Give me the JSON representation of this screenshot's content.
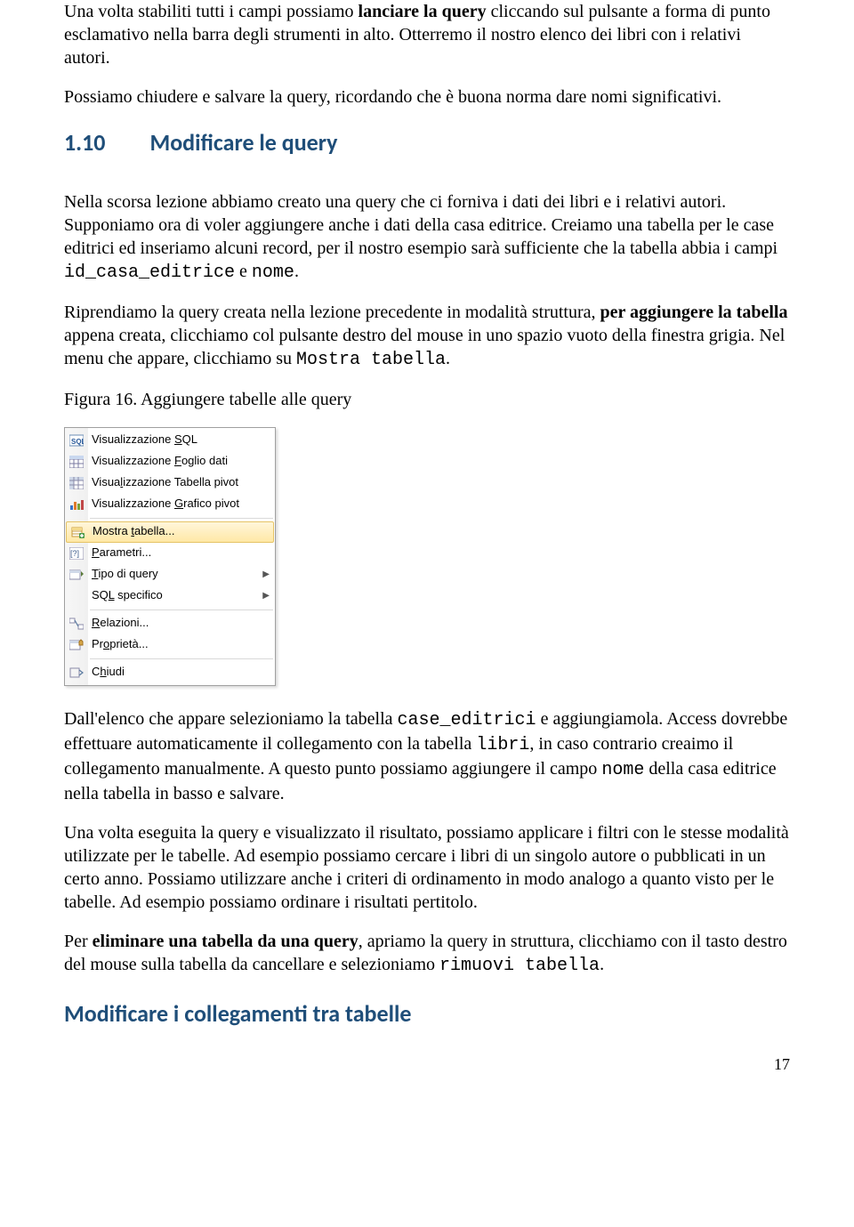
{
  "para1": "Una volta stabiliti tutti i campi possiamo lanciare la query cliccando sul pulsante a forma di punto esclamativo nella barra degli strumenti in alto. Otterremo il nostro elenco dei libri con i relativi autori.",
  "para2": "Possiamo chiudere e salvare la query, ricordando che è buona norma dare nomi significativi.",
  "heading": {
    "num": "1.10",
    "title": "Modificare le query"
  },
  "para3_a": "Nella scorsa lezione abbiamo creato una query che ci forniva i dati dei libri e i relativi autori. Supponiamo ora di voler aggiungere anche i dati della casa editrice. Creiamo una tabella per le case editrici ed inseriamo alcuni record, per il nostro esempio sarà sufficiente che la tabella abbia i campi ",
  "para3_code": "id_casa_editrice",
  "para3_b": " e ",
  "para3_code2": "nome",
  "para3_c": ".",
  "para4_a": "Riprendiamo la query creata nella lezione precedente in modalità struttura, ",
  "para4_bold": "per aggiungere la tabella",
  "para4_b": " appena creata, clicchiamo col pulsante destro del mouse in uno spazio vuoto della finestra grigia. Nel menu che appare, clicchiamo su ",
  "para4_code": "Mostra tabella",
  "para4_c": ".",
  "figure_caption": "Figura 16. Aggiungere tabelle alle query",
  "menu": {
    "items": [
      {
        "pre": "Visualizzazione ",
        "u": "S",
        "post": "QL",
        "icon": "sql",
        "arrow": false
      },
      {
        "pre": "Visualizzazione ",
        "u": "F",
        "post": "oglio dati",
        "icon": "grid",
        "arrow": false
      },
      {
        "pre": "Visua",
        "u": "l",
        "post": "izzazione Tabella pivot",
        "icon": "pivot-table",
        "arrow": false
      },
      {
        "pre": "Visualizzazione ",
        "u": "G",
        "post": "rafico pivot",
        "icon": "chart",
        "arrow": false
      },
      {
        "pre": "Mostra ",
        "u": "t",
        "post": "abella...",
        "icon": "add-table",
        "arrow": false,
        "highlight": true
      },
      {
        "pre": "",
        "u": "P",
        "post": "arametri...",
        "icon": "params",
        "arrow": false
      },
      {
        "pre": "",
        "u": "T",
        "post": "ipo di query",
        "icon": "query-type",
        "arrow": true
      },
      {
        "pre": "SQ",
        "u": "L",
        "post": " specifico",
        "icon": "",
        "arrow": true
      },
      {
        "pre": "",
        "u": "R",
        "post": "elazioni...",
        "icon": "relations",
        "arrow": false
      },
      {
        "pre": "Pr",
        "u": "o",
        "post": "prietà...",
        "icon": "properties",
        "arrow": false
      },
      {
        "pre": "C",
        "u": "h",
        "post": "iudi",
        "icon": "close",
        "arrow": false
      }
    ],
    "separators_after": [
      3,
      7,
      9
    ]
  },
  "para5_a": "Dall'elenco che appare selezioniamo la tabella ",
  "para5_code1": "case_editrici",
  "para5_b": " e aggiungiamola. Access dovrebbe effettuare automaticamente il collegamento con la tabella ",
  "para5_code2": "libri",
  "para5_c": ", in caso contrario creaimo il collegamento manualmente. A questo punto possiamo aggiungere il campo ",
  "para5_code3": "nome",
  "para5_d": " della casa editrice nella tabella in basso e salvare.",
  "para6": "Una volta eseguita la query e visualizzato il risultato, possiamo applicare i filtri con le stesse modalità utilizzate per le tabelle. Ad esempio possiamo cercare i libri di un singolo autore o pubblicati in un certo anno. Possiamo utilizzare anche i criteri di ordinamento in modo analogo a quanto visto per le tabelle. Ad esempio possiamo ordinare i risultati pertitolo.",
  "para7_a": "Per ",
  "para7_bold": "eliminare una tabella da una query",
  "para7_b": ", apriamo la query in struttura, clicchiamo con il tasto destro del mouse sulla tabella da cancellare e selezioniamo ",
  "para7_code": "rimuovi tabella",
  "para7_c": ".",
  "heading2": "Modificare i collegamenti tra tabelle",
  "page_number": "17"
}
